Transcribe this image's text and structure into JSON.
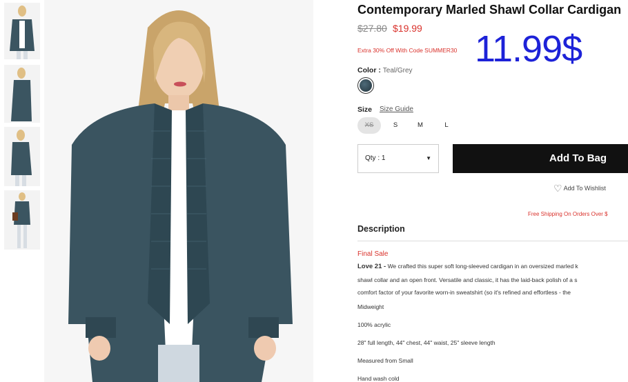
{
  "product": {
    "title": "Contemporary Marled Shawl Collar Cardigan",
    "price_original": "$27.80",
    "price_sale": "$19.99",
    "promo": "Extra 30% Off With Code SUMMER30",
    "overlay_price": "11.99$"
  },
  "color": {
    "label": "Color",
    "value": "Teal/Grey",
    "swatch_hex": "#2f4652"
  },
  "size": {
    "label": "Size",
    "guide": "Size Guide",
    "options": [
      "XS",
      "S",
      "M",
      "L"
    ],
    "selected": "XS",
    "selected_state": "unavailable"
  },
  "quantity": {
    "label": "Qty : 1",
    "caret": "▼"
  },
  "actions": {
    "add_to_bag": "Add To Bag",
    "wishlist": "Add To Wishlist",
    "wishlist_icon": "heart-outline-icon"
  },
  "shipping_note": "Free Shipping On Orders Over $",
  "description": {
    "heading": "Description",
    "final_sale": "Final Sale",
    "brand": "Love 21 -",
    "lines": [
      "We crafted this super soft long-sleeved cardigan in an oversized marled k",
      "shawl collar and an open front. Versatile and classic, it has the laid-back polish of a s",
      "comfort factor of your favorite worn-in sweatshirt (so it's refined and effortless - the"
    ],
    "details": [
      "Midweight",
      "100% acrylic",
      "28\" full length, 44\" chest, 44\" waist, 25\" sleeve length",
      "Measured from Small",
      "Hand wash cold"
    ]
  },
  "colors": {
    "sale_red": "#d9312b",
    "overlay_blue": "#1d22d8",
    "button_black": "#111111"
  }
}
